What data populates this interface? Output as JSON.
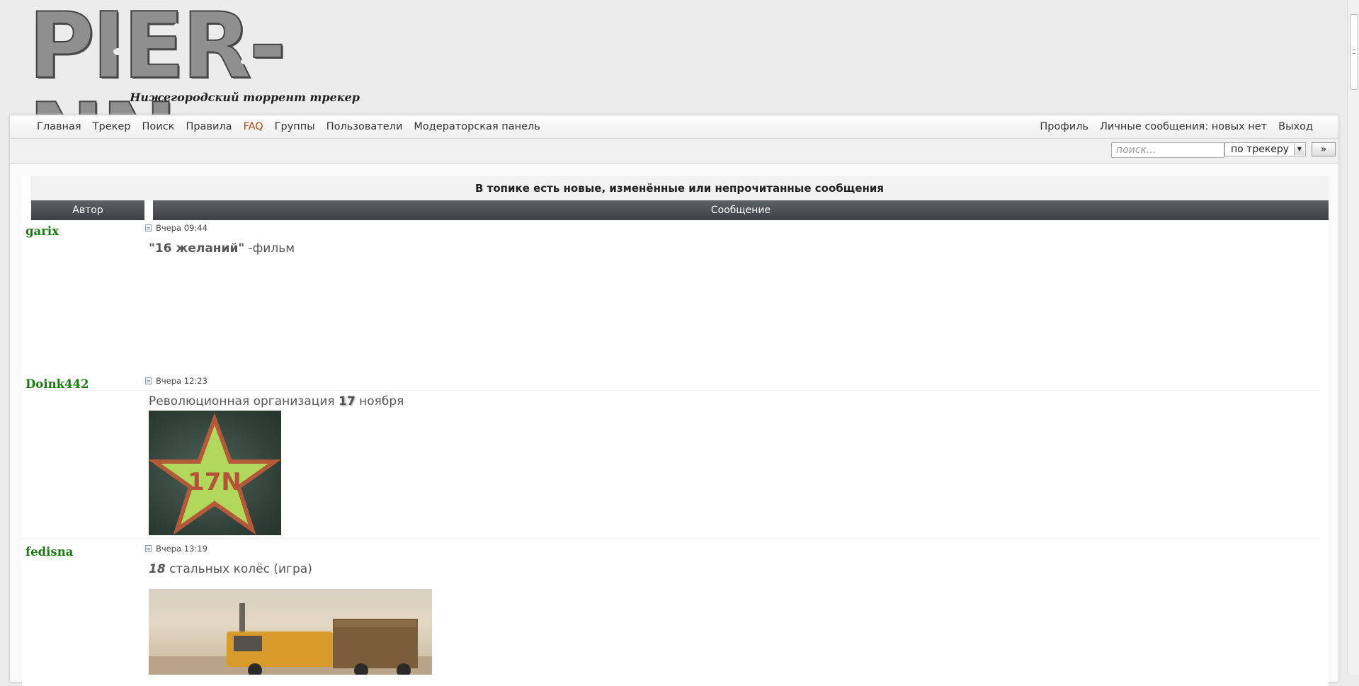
{
  "site": {
    "logo_text": "PIER-NN",
    "tagline": "Нижегородский торрент трекер"
  },
  "nav": {
    "left": [
      "Главная",
      "Трекер",
      "Поиск",
      "Правила",
      "FAQ",
      "Группы",
      "Пользователи",
      "Модераторская панель"
    ],
    "right": [
      "Профиль",
      "Личные сообщения: новых нет",
      "Выход"
    ]
  },
  "search": {
    "placeholder": "поиск...",
    "scope": "по трекеру",
    "go_label": "»"
  },
  "topic": {
    "title": "В топике есть новые, изменённые или непрочитанные сообщения",
    "col_author": "Автор",
    "col_message": "Сообщение"
  },
  "posts": [
    {
      "author": "garix",
      "time": "Вчера 09:44",
      "text_bold": "\"16 желаний\"",
      "text_rest": " -фильм"
    },
    {
      "author": "Doink442",
      "time": "Вчера 12:23",
      "text_pre": "Революционная организация ",
      "text_bold": "17",
      "text_post": " ноября",
      "image_label": "17N"
    },
    {
      "author": "fedisna",
      "time": "Вчера 13:19",
      "text_bold": "18",
      "text_rest": " стальных колёс (игра)"
    }
  ],
  "colors": {
    "author_green": "#1c7a12",
    "faq_orange": "#b8450a",
    "header_dark": "#4a4d51"
  }
}
